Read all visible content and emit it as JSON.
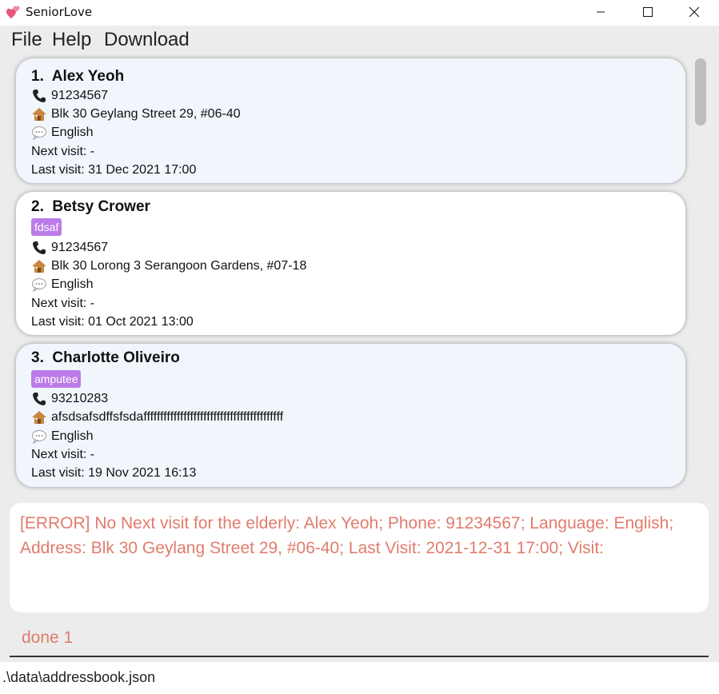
{
  "window": {
    "title": "SeniorLove",
    "app_icon": "two-hearts-icon",
    "controls": [
      "minimize-icon",
      "maximize-icon",
      "close-icon"
    ]
  },
  "menu": {
    "file": "File",
    "help": "Help",
    "download": "Download"
  },
  "icons": {
    "phone": "phone-icon",
    "address": "house-icon",
    "language": "speech-bubble-icon"
  },
  "colors": {
    "tag_bg": "#bb7be8",
    "error_text": "#e07c6c",
    "card_alt_bg": "#f1f5fc",
    "card_bg": "#ffffff"
  },
  "persons": [
    {
      "index": "1.",
      "name": "Alex Yeoh",
      "tag": "",
      "phone": "91234567",
      "address": "Blk 30 Geylang Street 29, #06-40",
      "language": "English",
      "next_visit": "Next visit: -",
      "last_visit": "Last visit: 31 Dec 2021 17:00"
    },
    {
      "index": "2.",
      "name": "Betsy Crower",
      "tag": "fdsaf",
      "phone": "91234567",
      "address": "Blk 30 Lorong 3 Serangoon Gardens, #07-18",
      "language": "English",
      "next_visit": "Next visit: -",
      "last_visit": "Last visit: 01 Oct 2021 13:00"
    },
    {
      "index": "3.",
      "name": "Charlotte Oliveiro",
      "tag": "amputee",
      "phone": "93210283",
      "address": "afsdsafsdffsfsdaffffffffffffffffffffffffffffffffffffffffff",
      "language": "English",
      "next_visit": "Next visit: -",
      "last_visit": "Last visit: 19 Nov 2021 16:13"
    }
  ],
  "result": {
    "message": "[ERROR] No Next visit for the elderly: Alex Yeoh; Phone: 91234567; Language: English; Address: Blk 30 Geylang Street 29, #06-40; Last Visit: 2021-12-31 17:00; Visit:"
  },
  "command": {
    "value": "done 1"
  },
  "status": {
    "file_path": ".\\data\\addressbook.json"
  }
}
